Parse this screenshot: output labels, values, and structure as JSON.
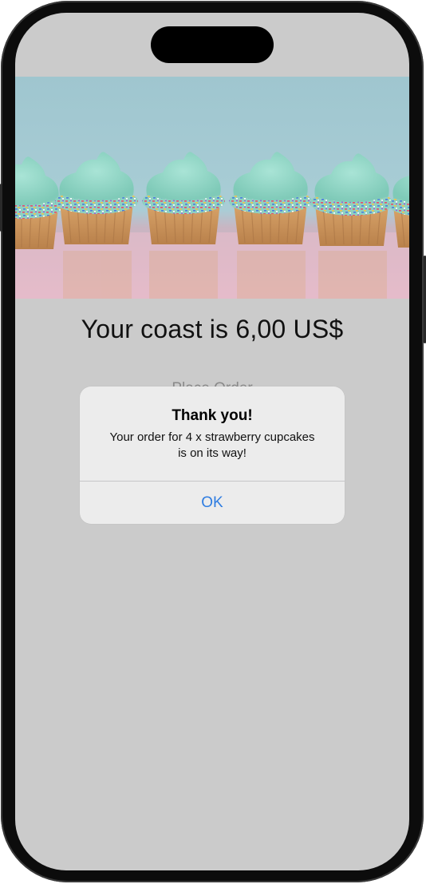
{
  "app": {
    "cost_label": "Your coast is 6,00 US$",
    "place_order_label": "Place Order",
    "hero_image": "cupcakes-photo"
  },
  "alert": {
    "title": "Thank you!",
    "message_line1": "Your order for 4 x strawberry cupcakes",
    "message_line2": "is on its way!",
    "ok_label": "OK"
  },
  "colors": {
    "accent": "#2f7de1",
    "screen_background": "#cbcbcb",
    "alert_background": "#ececec"
  }
}
